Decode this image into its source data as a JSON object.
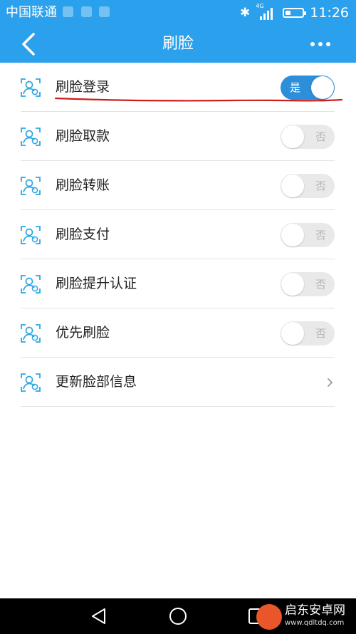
{
  "status_bar": {
    "carrier": "中国联通",
    "network": "4G",
    "time": "11:26"
  },
  "nav": {
    "title": "刷脸"
  },
  "settings": [
    {
      "label": "刷脸登录",
      "icon": "face-login-icon",
      "toggle": true,
      "on": true,
      "toggle_text": "是"
    },
    {
      "label": "刷脸取款",
      "icon": "face-withdraw-icon",
      "toggle": true,
      "on": false,
      "toggle_text": "否"
    },
    {
      "label": "刷脸转账",
      "icon": "face-transfer-icon",
      "toggle": true,
      "on": false,
      "toggle_text": "否"
    },
    {
      "label": "刷脸支付",
      "icon": "face-pay-icon",
      "toggle": true,
      "on": false,
      "toggle_text": "否"
    },
    {
      "label": "刷脸提升认证",
      "icon": "face-upgrade-auth-icon",
      "toggle": true,
      "on": false,
      "toggle_text": "否"
    },
    {
      "label": "优先刷脸",
      "icon": "face-priority-icon",
      "toggle": true,
      "on": false,
      "toggle_text": "否"
    },
    {
      "label": "更新脸部信息",
      "icon": "face-update-icon",
      "toggle": false
    }
  ],
  "colors": {
    "header": "#2ba0ec",
    "toggle_on": "#2d8fd9",
    "icon": "#2aa7e6",
    "annotation": "#cc1d1d"
  },
  "watermark": {
    "name": "启东安卓网",
    "url": "www.qdltdq.com"
  }
}
